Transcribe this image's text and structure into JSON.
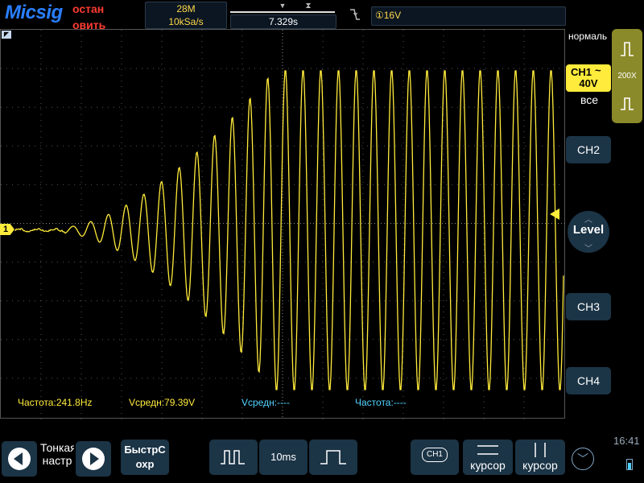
{
  "header": {
    "brand": "Micsig",
    "run_state": "остан",
    "run_state_2": "овить",
    "memory_depth": "28M",
    "sample_rate": "10kSa/s",
    "delay": "7.329s",
    "trigger_level": "①16V"
  },
  "icons": {
    "edge": "falling-edge-icon",
    "trig_pos": "trigger-position-icon"
  },
  "measurements": {
    "ch1_frequency": "Частота:241.8Hz",
    "ch1_vavg": "Vсредн:79.39V",
    "ch2_vavg": "Vсредн:----",
    "ch2_frequency": "Частота:----"
  },
  "right_panel": {
    "trigger_mode": "нормаль",
    "slope_ratio": "200X",
    "ch1_label": "CH1",
    "ch1_coupling": "~",
    "ch1_scale": "40V",
    "ch1_bandwidth": "все",
    "ch2_label": "CH2",
    "ch3_label": "CH3",
    "ch4_label": "CH4",
    "level_label": "Level"
  },
  "screen": {
    "ch1_marker": "1"
  },
  "bottom_bar": {
    "fine_label": "Тонкая настр",
    "quick_save": "БыстрС\nохр",
    "timebase": "10ms",
    "channel_select": "CH1",
    "h_cursor": "курсор",
    "v_cursor": "курсор",
    "clock": "16:41"
  },
  "colors": {
    "ch1": "#ffeb3b",
    "ch2": "#4fd3ff",
    "button_bg": "#1b3446",
    "brand": "#2a7fff",
    "stop": "#ff3b30"
  }
}
